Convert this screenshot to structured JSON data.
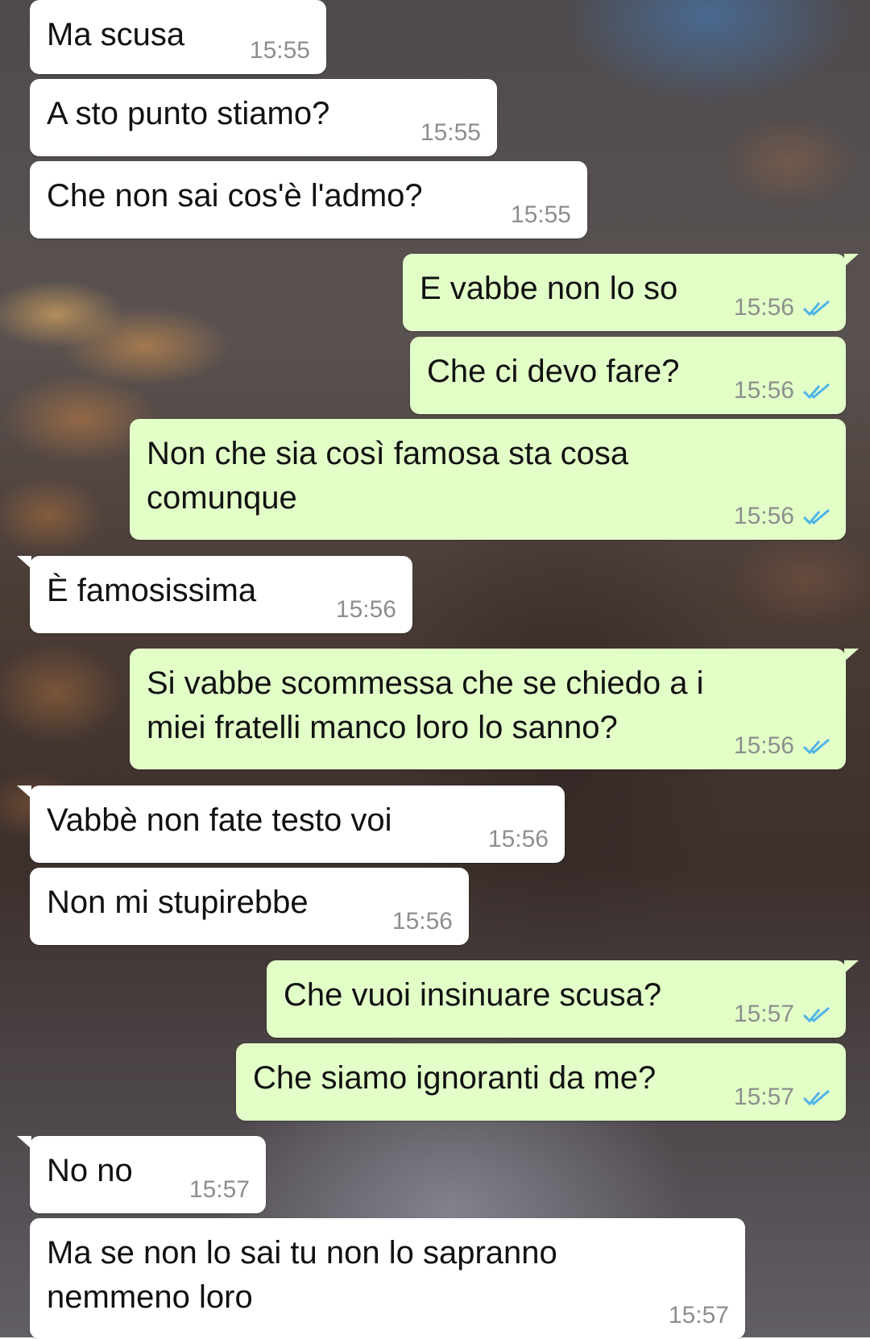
{
  "messages": [
    {
      "direction": "incoming",
      "text": "Ma scusa",
      "time": "15:55"
    },
    {
      "direction": "incoming",
      "text": "A sto punto stiamo?",
      "time": "15:55"
    },
    {
      "direction": "incoming",
      "text": "Che non sai cos'è l'admo?",
      "time": "15:55"
    },
    {
      "direction": "outgoing",
      "text": "E vabbe non lo so",
      "time": "15:56",
      "status": "read"
    },
    {
      "direction": "outgoing",
      "text": "Che ci devo fare?",
      "time": "15:56",
      "status": "read"
    },
    {
      "direction": "outgoing",
      "text": "Non che sia così famosa sta cosa\ncomunque",
      "time": "15:56",
      "status": "read"
    },
    {
      "direction": "incoming",
      "text": "È famosissima",
      "time": "15:56"
    },
    {
      "direction": "outgoing",
      "text": "Si vabbe scommessa che se chiedo a i\nmiei fratelli manco loro lo sanno?",
      "time": "15:56",
      "status": "read"
    },
    {
      "direction": "incoming",
      "text": "Vabbè non fate testo voi",
      "time": "15:56"
    },
    {
      "direction": "incoming",
      "text": "Non mi stupirebbe",
      "time": "15:56"
    },
    {
      "direction": "outgoing",
      "text": "Che vuoi insinuare scusa?",
      "time": "15:57",
      "status": "read"
    },
    {
      "direction": "outgoing",
      "text": "Che siamo ignoranti da me?",
      "time": "15:57",
      "status": "read"
    },
    {
      "direction": "incoming",
      "text": "No no",
      "time": "15:57"
    },
    {
      "direction": "incoming",
      "text": "Ma se non lo sai tu non lo sapranno\nnemmeno loro",
      "time": "15:57"
    }
  ],
  "colors": {
    "incoming_bubble": "#ffffff",
    "outgoing_bubble": "#e2ffc8",
    "timestamp": "#8c8f8c",
    "read_ticks": "#4fb3e8"
  },
  "icons": {
    "read_status": "double-check-icon"
  }
}
